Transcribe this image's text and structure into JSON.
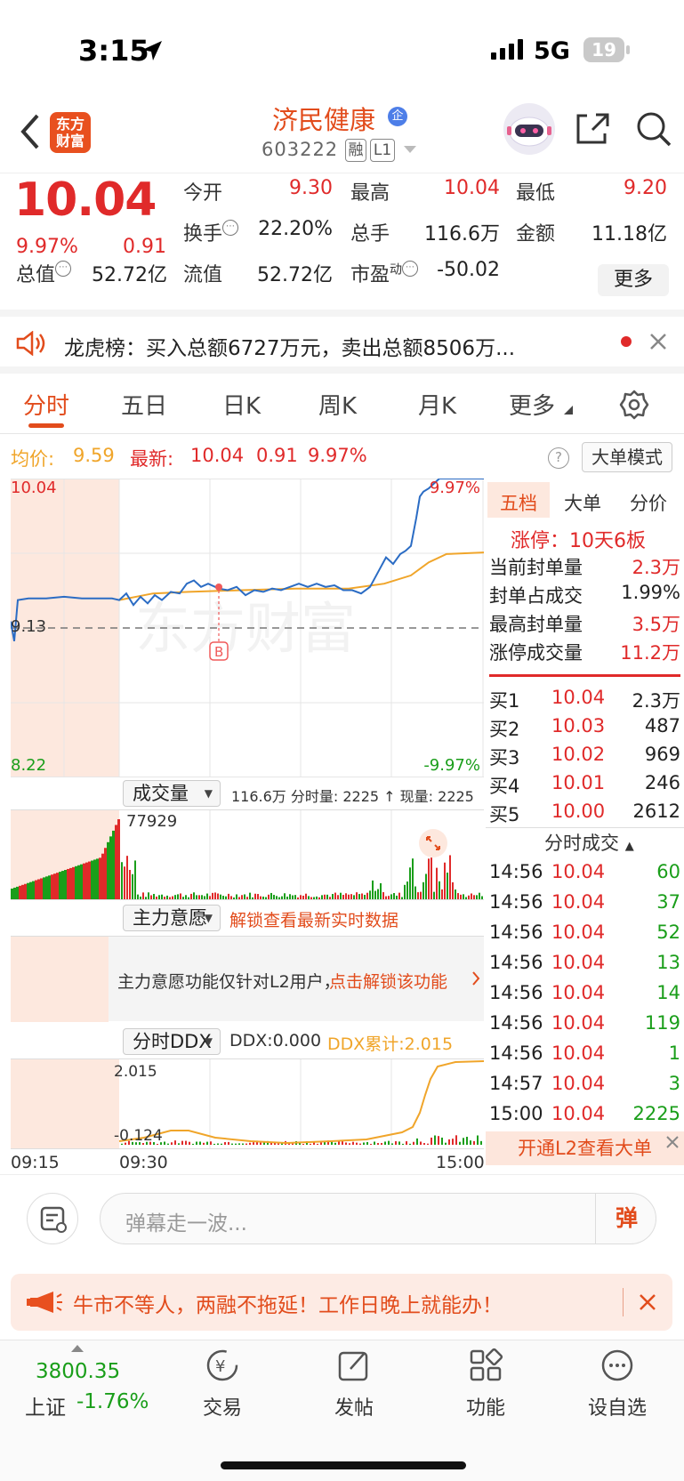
{
  "status_bar": {
    "time": "3:15",
    "network": "5G",
    "battery": "19"
  },
  "header": {
    "logo_text": "东方财富",
    "stock_name": "济民健康",
    "badge": "企",
    "code": "603222",
    "tags": [
      "融",
      "L1"
    ]
  },
  "quote": {
    "price": "10.04",
    "pct": "9.97%",
    "change": "0.91",
    "rows": [
      [
        {
          "label": "今开",
          "value": "9.30",
          "color": "red"
        },
        {
          "label": "最高",
          "value": "10.04",
          "color": "red"
        },
        {
          "label": "最低",
          "value": "9.20",
          "color": "red"
        }
      ],
      [
        {
          "label": "换手",
          "value": "22.20%",
          "color": "dark"
        },
        {
          "label": "总手",
          "value": "116.6万",
          "color": "dark"
        },
        {
          "label": "金额",
          "value": "11.18亿",
          "color": "dark"
        }
      ],
      [
        {
          "label": "总值",
          "value": "52.72亿",
          "color": "dark"
        },
        {
          "label": "流值",
          "value": "52.72亿",
          "color": "dark"
        },
        {
          "label": "市盈",
          "value": "-50.02",
          "color": "dark"
        }
      ]
    ],
    "pe_sup": "动",
    "more": "更多"
  },
  "notice": {
    "text": "龙虎榜：买入总额6727万元，卖出总额8506万..."
  },
  "tabs": [
    "分时",
    "五日",
    "日K",
    "周K",
    "月K",
    "更多"
  ],
  "chart_info": {
    "avg_label": "均价:",
    "avg_value": "9.59",
    "latest_label": "最新:",
    "latest_value": "10.04",
    "latest_change": "0.91",
    "latest_pct": "9.97%",
    "mode_button": "大单模式"
  },
  "chart_data": {
    "type": "line",
    "title": "",
    "ylim": [
      8.22,
      10.04
    ],
    "y_labels": {
      "top": "10.04",
      "mid": "9.13",
      "bottom": "8.22",
      "top_pct": "9.97%",
      "bottom_pct": "-9.97%"
    },
    "x_labels": [
      "09:15",
      "09:30",
      "15:00"
    ],
    "series": [
      {
        "name": "最新",
        "color": "#2b6cc4"
      },
      {
        "name": "均价",
        "color": "#f0a52a"
      }
    ],
    "price_x": [
      0,
      0.5,
      1,
      1.5,
      2,
      2.5,
      3,
      3.5,
      4,
      4.5,
      5,
      5.5,
      6,
      6.5,
      7,
      7.5,
      8,
      8.5,
      9,
      9.5,
      10,
      10.5,
      11,
      11.5,
      12,
      12.5,
      13,
      13.5,
      14,
      14.5,
      15,
      15.5,
      16,
      16.5,
      17,
      17.5,
      18,
      18.5,
      19,
      19.5,
      20,
      20.5,
      21,
      21.5,
      22,
      22.5,
      23,
      23.5,
      24,
      24.5,
      25
    ],
    "marker": "B"
  },
  "volume": {
    "selector": "成交量",
    "info": "116.6万 分时量: 2225 ↑ 现量: 2225",
    "max_label": "77929"
  },
  "wish": {
    "selector": "主力意愿",
    "unlock": "解锁查看最新实时数据",
    "notice": "主力意愿功能仅针对L2用户，",
    "link": "点击解锁该功能"
  },
  "ddx": {
    "selector": "分时DDX",
    "value": "DDX:0.000",
    "cum": "DDX累计:2.015",
    "top": "2.015",
    "bottom": "-0.124"
  },
  "right_panel": {
    "tabs": [
      "五档",
      "大单",
      "分价"
    ],
    "limit_up": "涨停：10天6板",
    "stats": [
      {
        "label": "当前封单量",
        "value": "2.3万",
        "color": "red"
      },
      {
        "label": "封单占成交",
        "value": "1.99%",
        "color": "dark"
      },
      {
        "label": "最高封单量",
        "value": "3.5万",
        "color": "red"
      },
      {
        "label": "涨停成交量",
        "value": "11.2万",
        "color": "red"
      }
    ],
    "bids": [
      {
        "label": "买1",
        "price": "10.04",
        "vol": "2.3万"
      },
      {
        "label": "买2",
        "price": "10.03",
        "vol": "487"
      },
      {
        "label": "买3",
        "price": "10.02",
        "vol": "969"
      },
      {
        "label": "买4",
        "price": "10.01",
        "vol": "246"
      },
      {
        "label": "买5",
        "price": "10.00",
        "vol": "2612"
      }
    ],
    "trades_title": "分时成交",
    "trades": [
      {
        "time": "14:56",
        "price": "10.04",
        "vol": "60"
      },
      {
        "time": "14:56",
        "price": "10.04",
        "vol": "37"
      },
      {
        "time": "14:56",
        "price": "10.04",
        "vol": "52"
      },
      {
        "time": "14:56",
        "price": "10.04",
        "vol": "13"
      },
      {
        "time": "14:56",
        "price": "10.04",
        "vol": "14"
      },
      {
        "time": "14:56",
        "price": "10.04",
        "vol": "119"
      },
      {
        "time": "14:56",
        "price": "10.04",
        "vol": "1"
      },
      {
        "time": "14:57",
        "price": "10.04",
        "vol": "3"
      },
      {
        "time": "15:00",
        "price": "10.04",
        "vol": "2225"
      }
    ],
    "l2_button": "开通L2查看大单"
  },
  "input": {
    "placeholder": "弹幕走一波...",
    "send": "弹"
  },
  "promo": {
    "text": "牛市不等人，两融不拖延！工作日晚上就能办！"
  },
  "bottom_nav": {
    "index_value": "3800.35",
    "index_name": "上证",
    "index_pct": "-1.76%",
    "items": [
      "交易",
      "发帖",
      "功能",
      "设自选"
    ]
  }
}
